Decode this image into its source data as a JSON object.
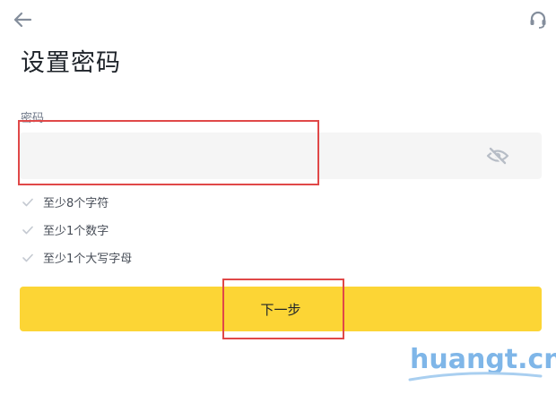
{
  "header": {
    "back_icon": "arrow-left-icon",
    "support_icon": "headset-icon",
    "title": "设置密码"
  },
  "form": {
    "password_label": "密码",
    "password_value": "",
    "password_placeholder": "",
    "visibility_icon": "eye-off-icon"
  },
  "rules": [
    {
      "label": "至少8个字符",
      "icon": "check-icon"
    },
    {
      "label": "至少1个数字",
      "icon": "check-icon"
    },
    {
      "label": "至少1个大写字母",
      "icon": "check-icon"
    }
  ],
  "actions": {
    "next_label": "下一步"
  },
  "watermark": {
    "text": "huangt.cn"
  },
  "colors": {
    "accent": "#fcd535",
    "input_bg": "#f5f5f5",
    "annotation": "#e04848",
    "watermark": "#7fb6e8"
  }
}
